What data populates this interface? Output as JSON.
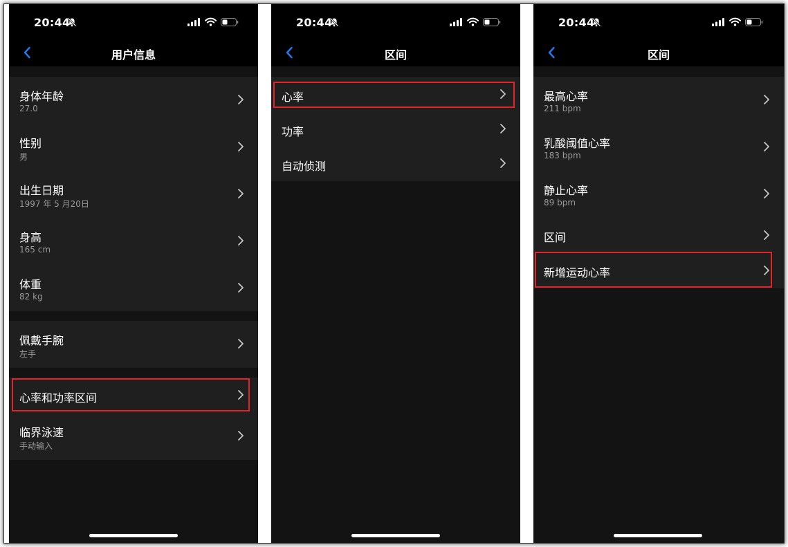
{
  "status": {
    "time": "20:44"
  },
  "screens": [
    {
      "title": "用户信息",
      "groups": [
        {
          "items": [
            {
              "label": "身体年龄",
              "value": "27.0"
            },
            {
              "label": "性别",
              "value": "男"
            },
            {
              "label": "出生日期",
              "value": "1997 年 5 月20日"
            },
            {
              "label": "身高",
              "value": "165 cm"
            },
            {
              "label": "体重",
              "value": "82 kg"
            }
          ]
        },
        {
          "items": [
            {
              "label": "佩戴手腕",
              "value": "左手"
            }
          ]
        },
        {
          "items": [
            {
              "label": "心率和功率区间",
              "highlighted": true
            },
            {
              "label": "临界泳速",
              "value": "手动输入"
            }
          ]
        }
      ]
    },
    {
      "title": "区间",
      "items": [
        {
          "label": "心率",
          "highlighted": true
        },
        {
          "label": "功率"
        },
        {
          "label": "自动侦测"
        }
      ]
    },
    {
      "title": "区间",
      "items": [
        {
          "label": "最高心率",
          "value": "211 bpm"
        },
        {
          "label": "乳酸阈值心率",
          "value": "183 bpm"
        },
        {
          "label": "静止心率",
          "value": "89 bpm"
        },
        {
          "label": "区间"
        },
        {
          "label": "新增运动心率",
          "highlighted": true
        }
      ]
    }
  ],
  "colors": {
    "background": "#131313",
    "bar": "#000000",
    "group": "#1f1f1f",
    "accent": "#1e7bf0",
    "highlight": "#e3232a",
    "secondary_text": "#9a9a9a"
  },
  "icons": {
    "back": "chevron-left-icon",
    "disclosure": "chevron-right-icon",
    "mute": "bell-slash-icon",
    "signal": "signal-icon",
    "wifi": "wifi-icon",
    "battery": "battery-icon"
  }
}
